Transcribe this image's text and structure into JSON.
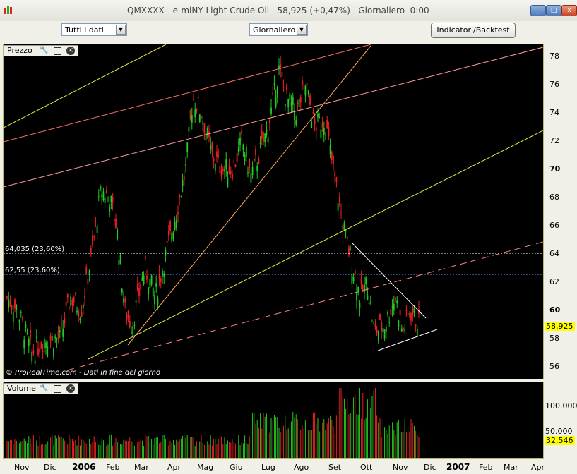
{
  "window": {
    "title": "QMXXXX - e-miNY Light Crude Oil   58,925 (+0,47%)   Giornaliero  0:00",
    "minimize": "_",
    "maximize": "□",
    "close": "x"
  },
  "toolbar": {
    "range_select": "Tutti i dati",
    "period_select": "Giornaliero",
    "indicators_button": "Indicatori/Backtest"
  },
  "price_panel": {
    "title": "Prezzo",
    "axis_ticks": [
      "78",
      "76",
      "74",
      "72",
      "70",
      "68",
      "66",
      "64",
      "62",
      "60",
      "58",
      "56"
    ],
    "last_value": "58,925",
    "fib_labels": [
      "64,035 (23,60%)",
      "62,55 (23,60%)"
    ],
    "credit": "© ProRealTime.com - Dati in fine del giorno"
  },
  "volume_panel": {
    "title": "Volume",
    "axis_ticks": [
      "100.000",
      "50.000"
    ],
    "last_value": "32.546"
  },
  "x_axis": {
    "labels": [
      "Nov",
      "Dic",
      "2006",
      "Feb",
      "Mar",
      "Apr",
      "Mag",
      "Giu",
      "Lug",
      "Ago",
      "Set",
      "Ott",
      "Nov",
      "Dic",
      "2007",
      "Feb",
      "Mar",
      "Apr"
    ]
  },
  "colors": {
    "up_candle": "#22cc22",
    "down_candle": "#ee2020",
    "panel_border": "#b9b86c",
    "highlight_value": "#ffff00"
  }
}
